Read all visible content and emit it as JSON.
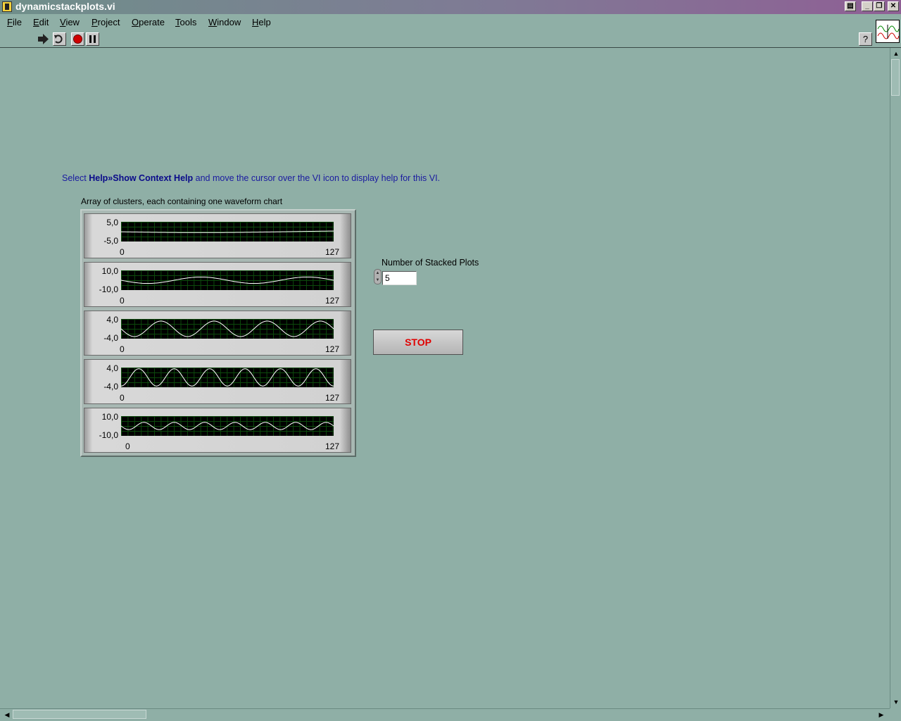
{
  "window": {
    "title": "dynamicstackplots.vi",
    "controls": [
      "print-icon",
      "minimize-icon",
      "restore-icon",
      "close-icon"
    ]
  },
  "menu": {
    "items": [
      {
        "label": "File",
        "mnemonic": "F"
      },
      {
        "label": "Edit",
        "mnemonic": "E"
      },
      {
        "label": "View",
        "mnemonic": "V"
      },
      {
        "label": "Project",
        "mnemonic": "P"
      },
      {
        "label": "Operate",
        "mnemonic": "O"
      },
      {
        "label": "Tools",
        "mnemonic": "T"
      },
      {
        "label": "Window",
        "mnemonic": "W"
      },
      {
        "label": "Help",
        "mnemonic": "H"
      }
    ]
  },
  "toolbar": {
    "buttons": [
      "run-icon",
      "run-continuously-icon",
      "abort-icon",
      "pause-icon"
    ],
    "help_button": "context-help-icon",
    "vi_icon": "waveform-vi-icon"
  },
  "panel": {
    "help_prefix": "Select ",
    "help_bold": "Help»Show Context Help",
    "help_suffix": " and move the cursor over the VI icon to display help for this VI.",
    "array_label": "Array of clusters, each containing one waveform chart",
    "number_label": "Number of Stacked Plots",
    "number_value": "5",
    "stop_label": "STOP"
  },
  "charts": [
    {
      "ymax": "5,0",
      "ymin": "-5,0",
      "xmin": "0",
      "xmax": "127",
      "amplitude": 0.1,
      "cycles": 0.6,
      "phase": 3.3
    },
    {
      "ymax": "10,0",
      "ymin": "-10,0",
      "xmin": "0",
      "xmax": "127",
      "amplitude": 0.35,
      "cycles": 2,
      "phase": 3.14
    },
    {
      "ymax": "4,0",
      "ymin": "-4,0",
      "xmin": "0",
      "xmax": "127",
      "amplitude": 0.85,
      "cycles": 4,
      "phase": 3.14
    },
    {
      "ymax": "4,0",
      "ymin": "-4,0",
      "xmin": "0",
      "xmax": "127",
      "amplitude": 0.95,
      "cycles": 6,
      "phase": 4.712
    },
    {
      "ymax": "10,0",
      "ymin": "-10,0",
      "xmin": "0",
      "xmax": "127",
      "amplitude": 0.4,
      "cycles": 7,
      "phase": 3.14
    }
  ],
  "colors": {
    "panel_bg": "#8fafa6",
    "help_text": "#1a1aa0",
    "stop_text": "#e00000",
    "plot_bg": "#000000",
    "plot_trace": "#ffffff",
    "plot_grid": "#0c4a0c"
  }
}
